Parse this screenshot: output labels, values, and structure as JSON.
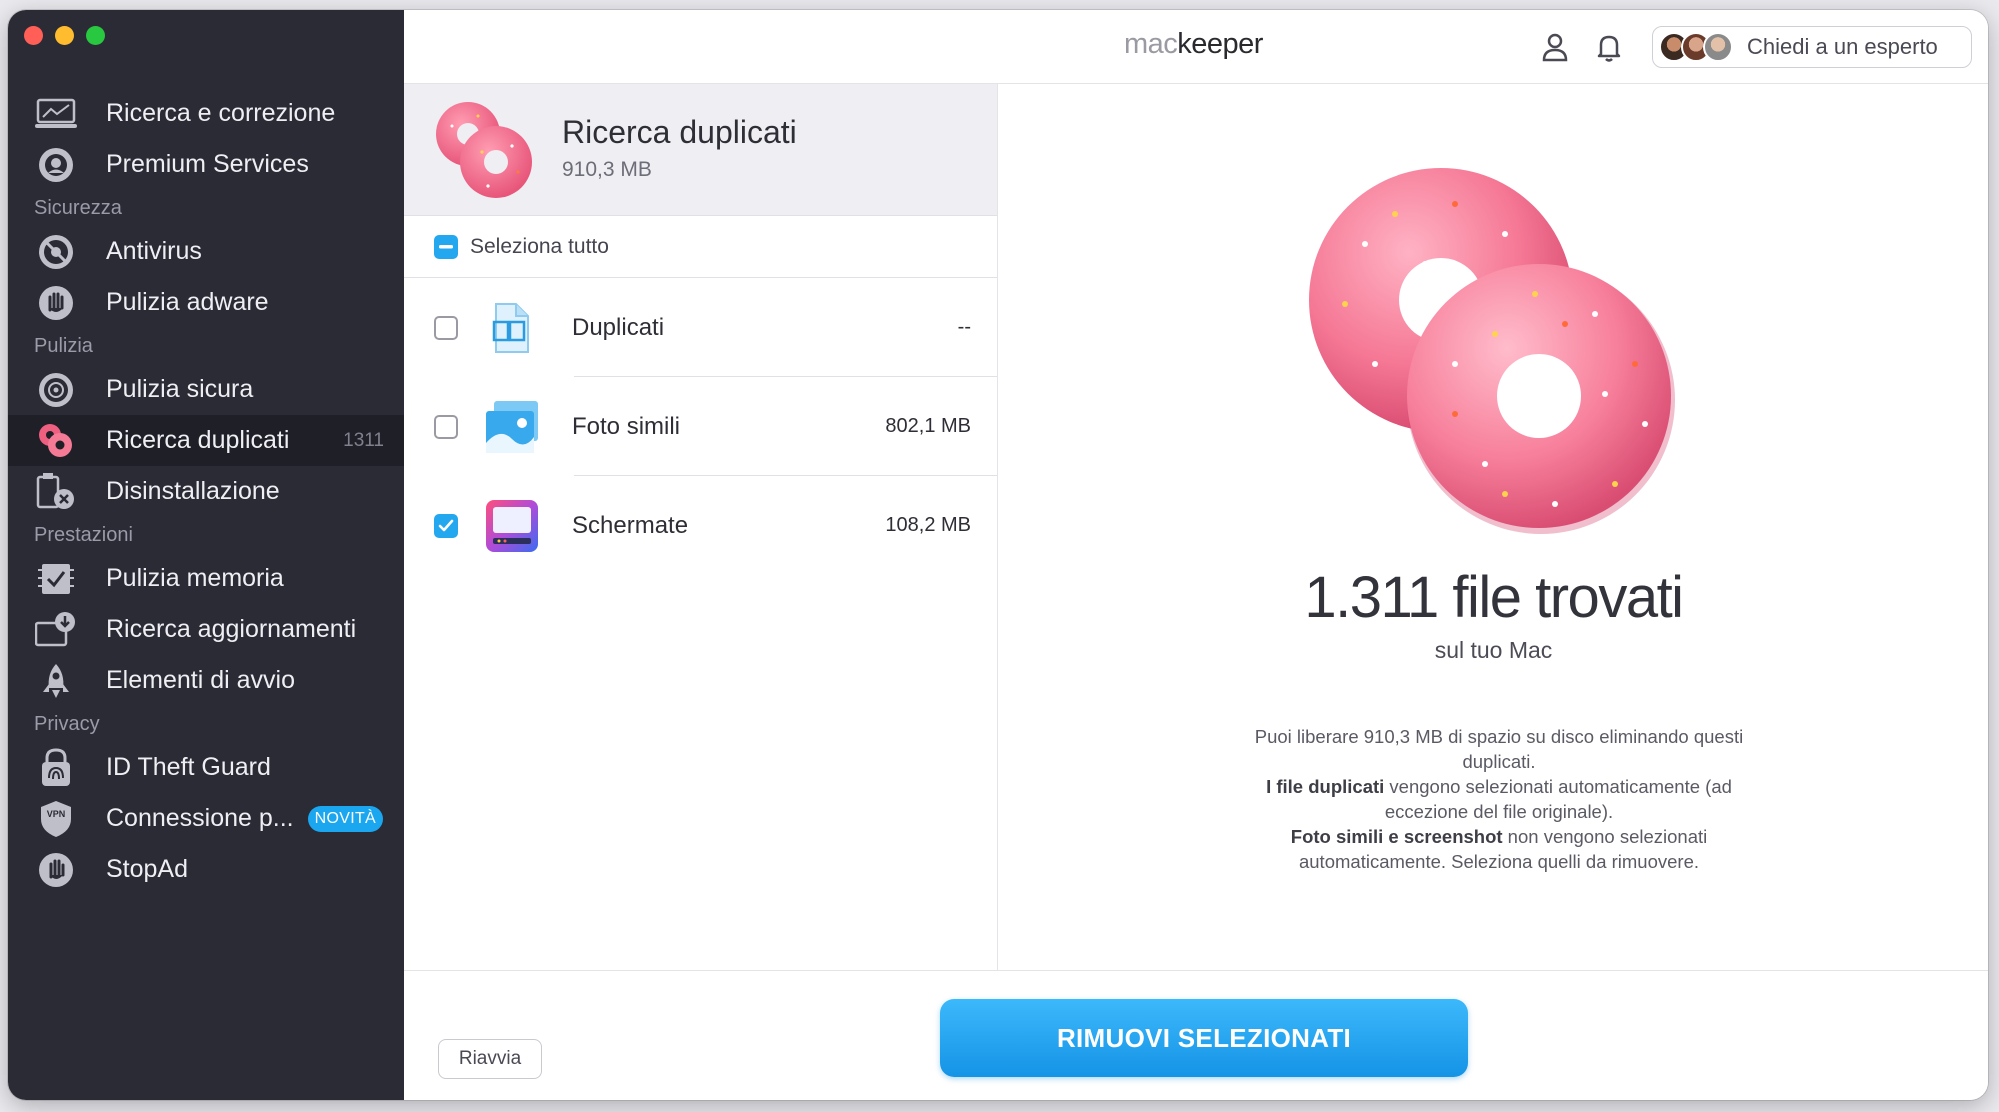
{
  "window": {
    "controls": [
      "close",
      "minimize",
      "zoom"
    ]
  },
  "sidebar": {
    "items": [
      {
        "label": "Ricerca e correzione",
        "icon": "laptop-scan-icon"
      },
      {
        "label": "Premium Services",
        "icon": "headset-icon"
      },
      {
        "section": "Sicurezza"
      },
      {
        "label": "Antivirus",
        "icon": "antivirus-icon"
      },
      {
        "label": "Pulizia adware",
        "icon": "hand-stop-icon"
      },
      {
        "section": "Pulizia"
      },
      {
        "label": "Pulizia sicura",
        "icon": "disk-clean-icon"
      },
      {
        "label": "Ricerca duplicati",
        "icon": "donut-icon",
        "count": "1311",
        "active": true
      },
      {
        "label": "Disinstallazione",
        "icon": "uninstall-icon"
      },
      {
        "section": "Prestazioni"
      },
      {
        "label": "Pulizia memoria",
        "icon": "memory-check-icon"
      },
      {
        "label": "Ricerca aggiornamenti",
        "icon": "update-download-icon"
      },
      {
        "label": "Elementi di avvio",
        "icon": "rocket-icon"
      },
      {
        "section": "Privacy"
      },
      {
        "label": "ID Theft Guard",
        "icon": "fingerprint-icon"
      },
      {
        "label": "Connessione p...",
        "icon": "vpn-shield-icon",
        "badge": "NOVITÀ"
      },
      {
        "label": "StopAd",
        "icon": "stopad-hand-icon"
      }
    ]
  },
  "header": {
    "brand_light": "mac",
    "brand_dark": "keeper",
    "expert_label": "Chiedi a un esperto"
  },
  "panel": {
    "title": "Ricerca duplicati",
    "size": "910,3 MB",
    "select_all_label": "Seleziona tutto",
    "rows": [
      {
        "label": "Duplicati",
        "size": "--",
        "checked": false,
        "icon": "duplicate-files-icon"
      },
      {
        "label": "Foto simili",
        "size": "802,1 MB",
        "checked": false,
        "icon": "similar-photos-icon"
      },
      {
        "label": "Schermate",
        "size": "108,2 MB",
        "checked": true,
        "icon": "screenshots-icon"
      }
    ]
  },
  "result": {
    "count_text": "1.311 file trovati",
    "subtitle": "sul tuo Mac",
    "info_line1": "Puoi liberare 910,3 MB di spazio su disco eliminando questi duplicati.",
    "info_bold2": "I file duplicati",
    "info_line2": " vengono selezionati automaticamente (ad eccezione del file originale).",
    "info_bold3": "Foto simili e screenshot",
    "info_line3": " non vengono selezionati automaticamente. Seleziona quelli da rimuovere."
  },
  "footer": {
    "restart_label": "Riavvia",
    "remove_label": "RIMUOVI SELEZIONATI"
  },
  "colors": {
    "sidebar_bg": "#2b2b36",
    "accent": "#23a8ef",
    "donut_pink": "#f06a8a"
  }
}
